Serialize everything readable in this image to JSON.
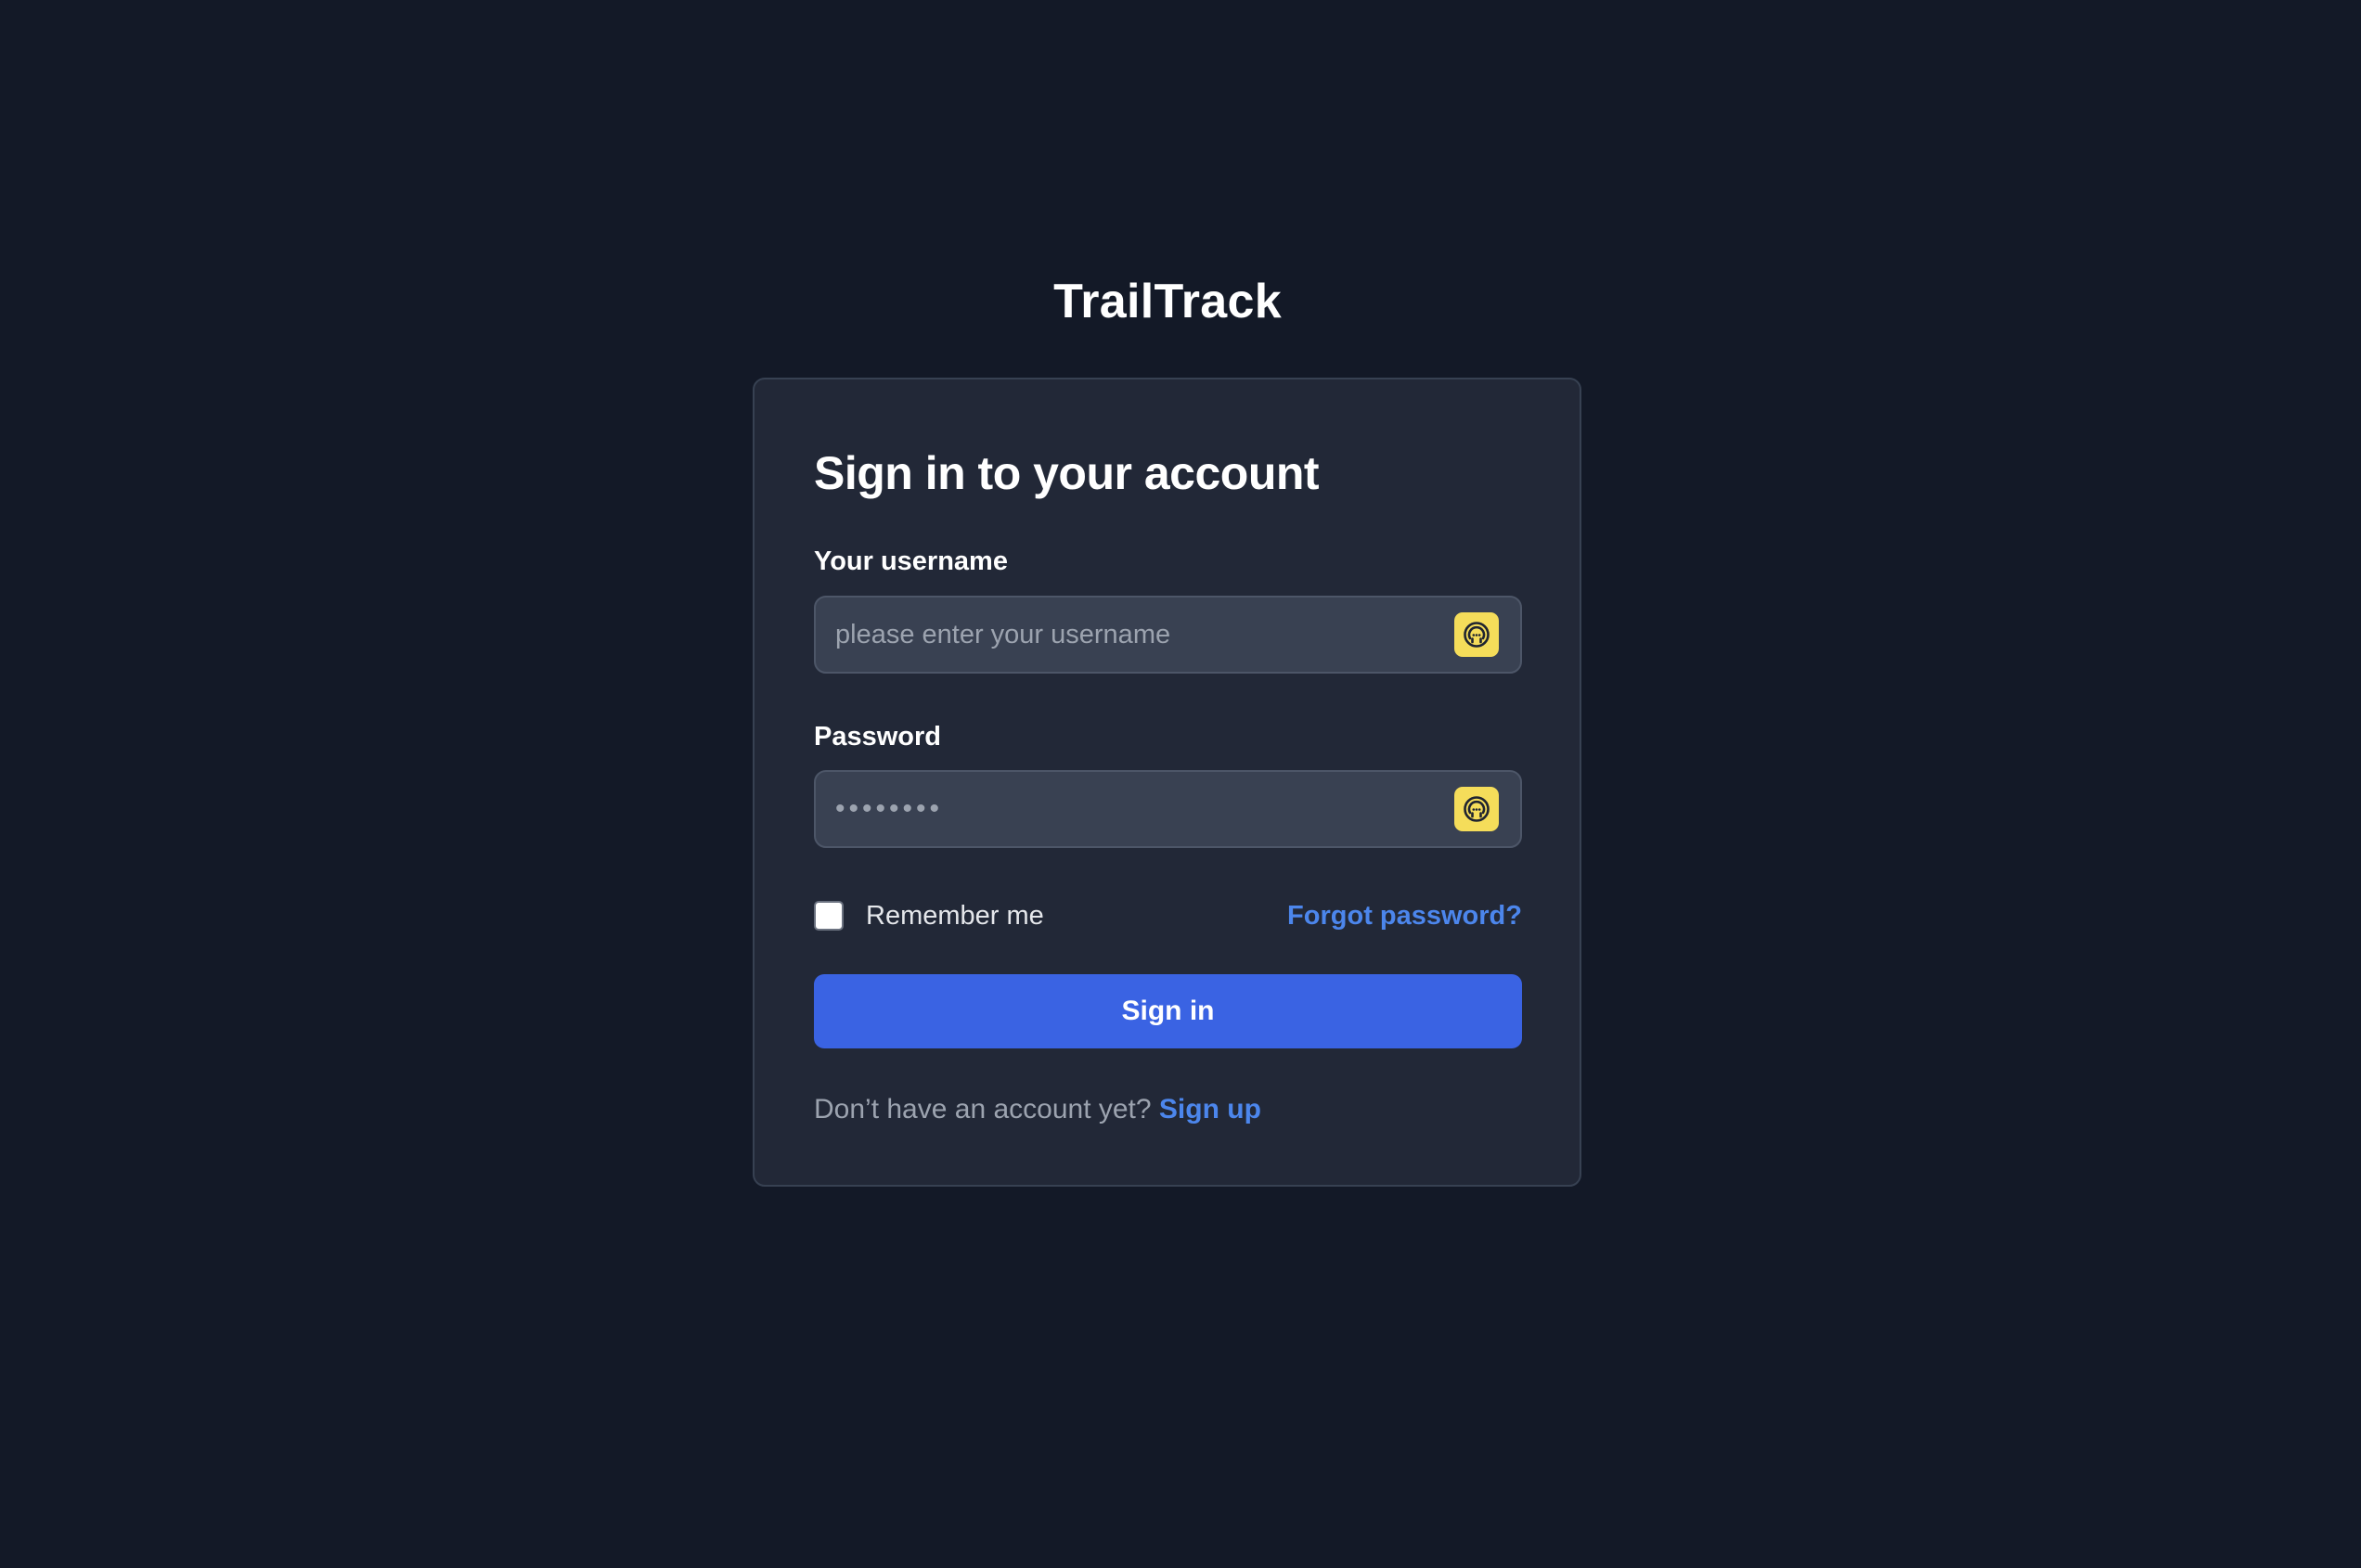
{
  "brand": {
    "name": "TrailTrack"
  },
  "login": {
    "title": "Sign in to your account",
    "username": {
      "label": "Your username",
      "placeholder": "please enter your username",
      "value": ""
    },
    "password": {
      "label": "Password",
      "value": "••••••••"
    },
    "remember_me": {
      "label": "Remember me",
      "checked": false
    },
    "forgot_password_label": "Forgot password?",
    "submit_label": "Sign in",
    "signup_prompt": "Don’t have an account yet?",
    "signup_label": "Sign up"
  },
  "icons": {
    "password_manager": "password-manager-icon"
  },
  "colors": {
    "background": "#131927",
    "card": "#222837",
    "input": "#394152",
    "accent": "#3a63e3",
    "link": "#4c86ec",
    "manager_icon": "#f5dd5a"
  }
}
